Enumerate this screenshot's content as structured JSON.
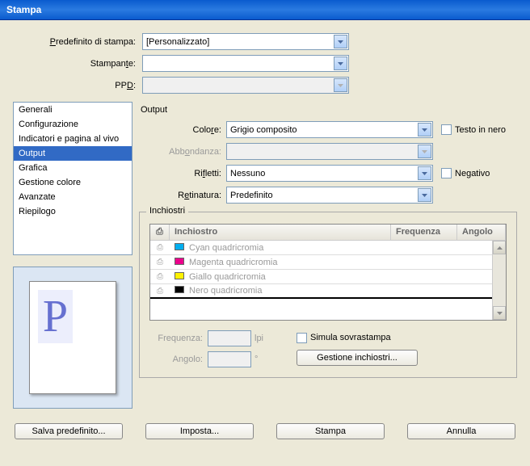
{
  "window": {
    "title": "Stampa"
  },
  "top": {
    "preset_label": "Predefinito di stampa:",
    "preset_value": "[Personalizzato]",
    "printer_label": "Stampante:",
    "printer_value": "",
    "ppd_label": "PPD:",
    "ppd_value": ""
  },
  "sidebar": {
    "items": [
      {
        "label": "Generali"
      },
      {
        "label": "Configurazione"
      },
      {
        "label": "Indicatori e pagina al vivo"
      },
      {
        "label": "Output"
      },
      {
        "label": "Grafica"
      },
      {
        "label": "Gestione colore"
      },
      {
        "label": "Avanzate"
      },
      {
        "label": "Riepilogo"
      }
    ],
    "selected": "Output"
  },
  "output": {
    "title": "Output",
    "color_label": "Colore:",
    "color_value": "Grigio composito",
    "text_black_label": "Testo in nero",
    "abbond_label": "Abbondanza:",
    "riflet_label": "Rifletti:",
    "riflet_value": "Nessuno",
    "neg_label": "Negativo",
    "retin_label": "Retinatura:",
    "retin_value": "Predefinito"
  },
  "inks": {
    "title": "Inchiostri",
    "headers": {
      "name": "Inchiostro",
      "freq": "Frequenza",
      "ang": "Angolo"
    },
    "rows": [
      {
        "name": "Cyan quadricromia",
        "color": "#00aeef"
      },
      {
        "name": "Magenta quadricromia",
        "color": "#ec008c"
      },
      {
        "name": "Giallo quadricromia",
        "color": "#fff200"
      },
      {
        "name": "Nero quadricromia",
        "color": "#000000"
      }
    ],
    "freq_label": "Frequenza:",
    "freq_unit": "lpi",
    "ang_label": "Angolo:",
    "ang_unit": "°",
    "simulate_label": "Simula sovrastampa",
    "manage_btn": "Gestione inchiostri..."
  },
  "buttons": {
    "save": "Salva predefinito...",
    "setup": "Imposta...",
    "print": "Stampa",
    "cancel": "Annulla"
  }
}
